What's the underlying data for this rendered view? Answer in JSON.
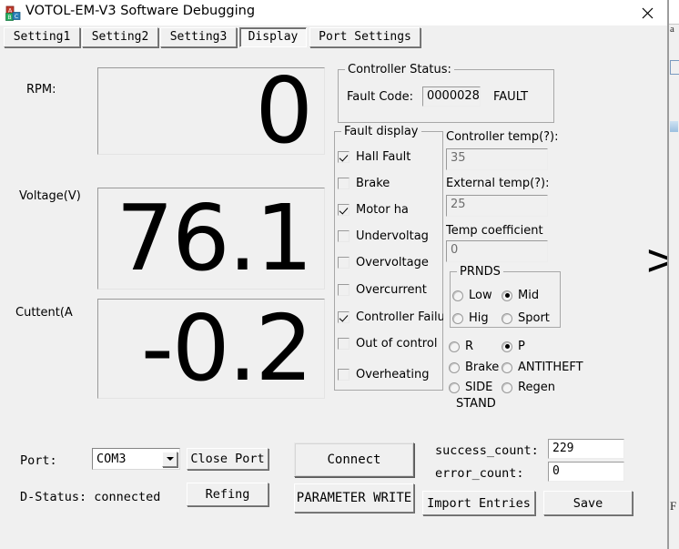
{
  "window": {
    "title": "VOTOL-EM-V3 Software Debugging",
    "icon": "app-blocks-icon",
    "close_label": "✕",
    "bg_color": "#f0f0f0",
    "titlebar_color": "#ffffff"
  },
  "tabs": [
    {
      "label": "Setting1",
      "selected": false
    },
    {
      "label": "Setting2",
      "selected": false
    },
    {
      "label": "Setting3",
      "selected": false
    },
    {
      "label": "Display",
      "selected": true
    },
    {
      "label": "Port Settings",
      "selected": false
    }
  ],
  "gauges": [
    {
      "label": "RPM:",
      "value": "0"
    },
    {
      "label": "Voltage(V)",
      "value": "76.1"
    },
    {
      "label": "Cuttent(A",
      "value": "-0.2"
    }
  ],
  "controller_status": {
    "title": "Controller Status:",
    "fault_code_label": "Fault Code:",
    "fault_code_value": "0000028",
    "fault_state": "FAULT"
  },
  "fault_display": {
    "title": "Fault display",
    "items": [
      {
        "label": "Hall Fault",
        "checked": true
      },
      {
        "label": "Brake",
        "checked": false
      },
      {
        "label": "Motor ha",
        "checked": true
      },
      {
        "label": "Undervoltag",
        "checked": false
      },
      {
        "label": "Overvoltage",
        "checked": false
      },
      {
        "label": "Overcurrent",
        "checked": false
      },
      {
        "label": "Controller Failure",
        "checked": true
      },
      {
        "label": "Out of control",
        "checked": false
      },
      {
        "label": "Overheating",
        "checked": false
      }
    ]
  },
  "temps": [
    {
      "label": "Controller temp(?):",
      "value": "35"
    },
    {
      "label": "External temp(?):",
      "value": "25"
    },
    {
      "label": "Temp coefficient",
      "value": "0"
    }
  ],
  "prnds": {
    "title": "PRNDS",
    "options": [
      {
        "label": "Low",
        "selected": false
      },
      {
        "label": "Mid",
        "selected": true
      },
      {
        "label": "Hig",
        "selected": false
      },
      {
        "label": "Sport",
        "selected": false
      }
    ]
  },
  "gear_flags": [
    {
      "label": "R",
      "selected": false
    },
    {
      "label": "P",
      "selected": true
    },
    {
      "label": "Brake",
      "selected": false
    },
    {
      "label": "ANTITHEFT",
      "selected": false
    },
    {
      "label": "SIDE",
      "selected": false
    },
    {
      "label": "Regen",
      "selected": false
    }
  ],
  "side_stand_second_line": "STAND",
  "port_bar": {
    "port_label": "Port:",
    "port_value": "COM3",
    "close_port_label": "Close Port",
    "status_label": "D-Status: connected",
    "refresh_label": "Refing"
  },
  "actions": {
    "connect_label": "Connect",
    "parameter_write_label": "PARAMETER WRITE",
    "import_entries_label": "Import Entries",
    "save_label": "Save"
  },
  "counters": [
    {
      "label": "success_count:",
      "value": "229"
    },
    {
      "label": "error_count:",
      "value": "0"
    }
  ],
  "overlay": {
    "chevron": ">"
  },
  "background_window": {
    "letter_top": "a",
    "letter_bottom": "F"
  }
}
